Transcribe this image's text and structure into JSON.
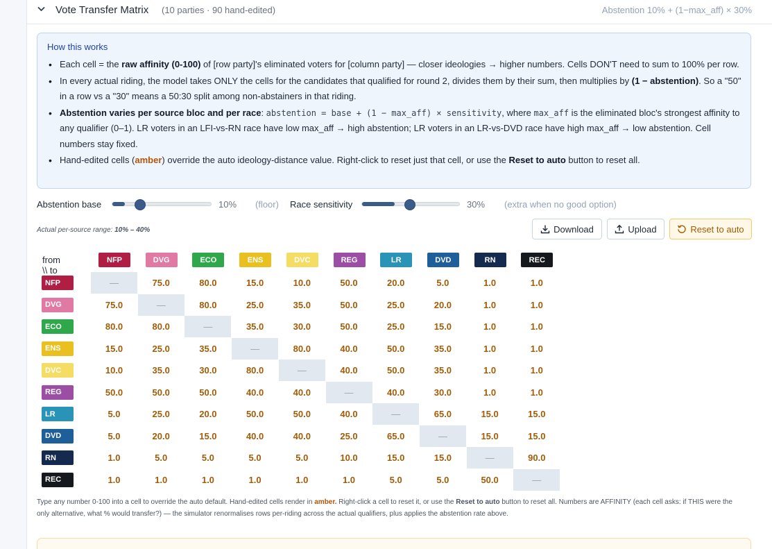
{
  "header": {
    "title": "Vote Transfer Matrix",
    "subtitle": "(10 parties · 90 hand-edited)",
    "formula": "Abstention 10% + (1−max_aff) × 30%"
  },
  "info": {
    "title": "How this works",
    "b1": {
      "t1": "Each cell = the ",
      "b": "raw affinity (0-100)",
      "t2": " of [row party]'s eliminated voters for [column party] — closer ideologies → higher numbers. Cells DON'T need to sum to 100% per row."
    },
    "b2": {
      "t1": "In every actual riding, the model takes ONLY the cells for the candidates that qualified for round 2, divides them by their sum, then multiplies by ",
      "b": "(1 − abstention)",
      "t2": ". So a \"50\" in a row vs a \"30\" means a 50:30 split among non-abstainers in that riding."
    },
    "b3": {
      "b": "Abstention varies per source bloc and per race",
      "t1": ": ",
      "code1": "abstention = base + (1 − max_aff) × sensitivity",
      "t2": ", where ",
      "code2": "max_aff",
      "t3": " is the eliminated bloc's strongest affinity to any qualifier (0–1). LR voters in an LFI-vs-RN race have low max_aff → high abstention; LR voters in an LR-vs-DVD race have high max_aff → low abstention. Cell numbers stay fixed."
    },
    "b4": {
      "t1": "Hand-edited cells (",
      "amber": "amber",
      "t2": ") override the auto ideology-distance value. Right-click to reset just that cell, or use the ",
      "b": "Reset to auto",
      "t3": " button to reset all."
    }
  },
  "controls": {
    "abstention_label": "Abstention base",
    "abstention_value": "10%",
    "abstention_level": 0.1,
    "abstention_note": "(floor)",
    "sensitivity_label": "Race sensitivity",
    "sensitivity_value": "30%",
    "sensitivity_level": 0.3,
    "sensitivity_note": "(extra when no good option)",
    "range_prefix": "Actual per-source range: ",
    "range_value": "10% – 40%",
    "download_label": "Download",
    "upload_label": "Upload",
    "reset_label": "Reset to auto"
  },
  "matrix": {
    "corner": "from \\\\ to",
    "diagonal": "—",
    "parties": [
      {
        "code": "NFP",
        "bg": "#b01e44",
        "fg": "#ffffff"
      },
      {
        "code": "DVG",
        "bg": "#e07aa5",
        "fg": "#ffffff"
      },
      {
        "code": "ECO",
        "bg": "#2ea84a",
        "fg": "#ffffff"
      },
      {
        "code": "ENS",
        "bg": "#e9c020",
        "fg": "#ffffff"
      },
      {
        "code": "DVC",
        "bg": "#f5dc62",
        "fg": "#ffffff"
      },
      {
        "code": "REG",
        "bg": "#9b4ea3",
        "fg": "#ffffff"
      },
      {
        "code": "LR",
        "bg": "#2a94b8",
        "fg": "#ffffff"
      },
      {
        "code": "DVD",
        "bg": "#1f5f99",
        "fg": "#ffffff"
      },
      {
        "code": "RN",
        "bg": "#142a4e",
        "fg": "#ffffff"
      },
      {
        "code": "REC",
        "bg": "#15181c",
        "fg": "#ffffff"
      }
    ],
    "values": [
      [
        null,
        "75.0",
        "80.0",
        "15.0",
        "10.0",
        "50.0",
        "20.0",
        "5.0",
        "1.0",
        "1.0"
      ],
      [
        "75.0",
        null,
        "80.0",
        "25.0",
        "35.0",
        "50.0",
        "25.0",
        "20.0",
        "1.0",
        "1.0"
      ],
      [
        "80.0",
        "80.0",
        null,
        "35.0",
        "30.0",
        "50.0",
        "25.0",
        "15.0",
        "1.0",
        "1.0"
      ],
      [
        "15.0",
        "25.0",
        "35.0",
        null,
        "80.0",
        "40.0",
        "50.0",
        "35.0",
        "1.0",
        "1.0"
      ],
      [
        "10.0",
        "35.0",
        "30.0",
        "80.0",
        null,
        "40.0",
        "50.0",
        "35.0",
        "1.0",
        "1.0"
      ],
      [
        "50.0",
        "50.0",
        "50.0",
        "40.0",
        "40.0",
        null,
        "40.0",
        "30.0",
        "1.0",
        "1.0"
      ],
      [
        "5.0",
        "25.0",
        "20.0",
        "50.0",
        "50.0",
        "40.0",
        null,
        "65.0",
        "15.0",
        "15.0"
      ],
      [
        "5.0",
        "20.0",
        "15.0",
        "40.0",
        "40.0",
        "25.0",
        "65.0",
        null,
        "15.0",
        "15.0"
      ],
      [
        "1.0",
        "5.0",
        "5.0",
        "5.0",
        "5.0",
        "10.0",
        "15.0",
        "15.0",
        null,
        "90.0"
      ],
      [
        "1.0",
        "1.0",
        "1.0",
        "1.0",
        "1.0",
        "1.0",
        "5.0",
        "5.0",
        "50.0",
        null
      ]
    ]
  },
  "footnote": {
    "t1": "Type any number 0-100 into a cell to override the auto default. Hand-edited cells render in ",
    "amber": "amber.",
    "t2": " Right-click a cell to reset it, or use the ",
    "b": "Reset to auto",
    "t3": " button to reset all. Numbers are AFFINITY (each cell asks: if THIS were the only alternative, what % would transfer?) — the simulator renormalises rows per-riding across the actual qualifiers, plus applies the abstention rate above."
  }
}
